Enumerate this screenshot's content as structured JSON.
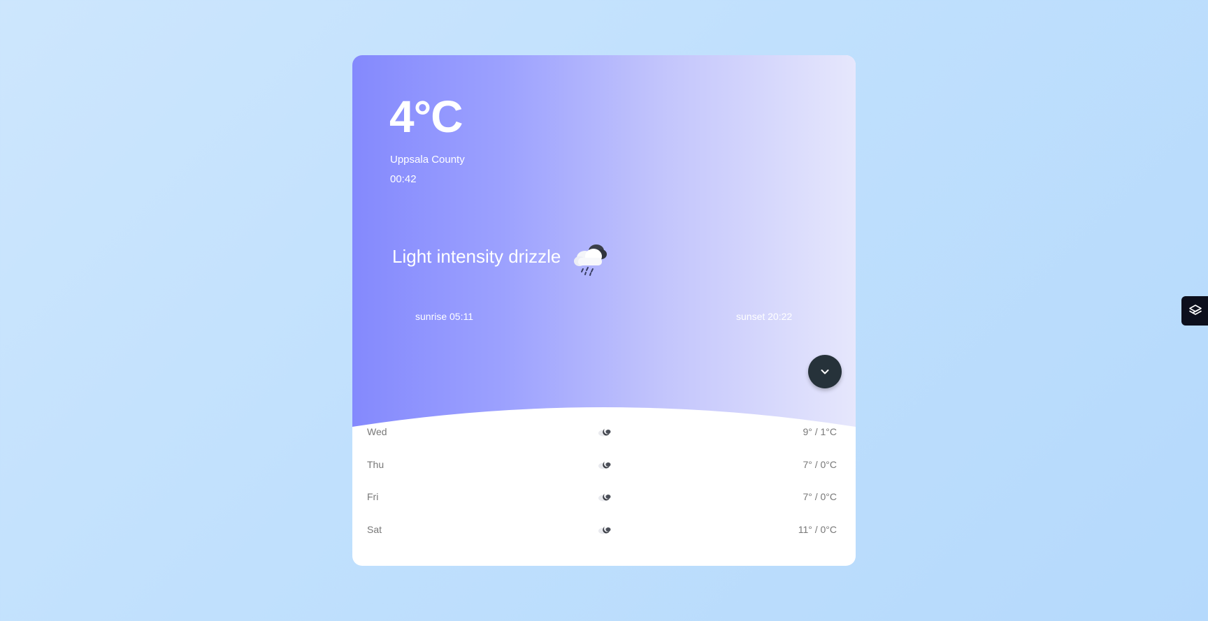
{
  "current": {
    "temperature": "4°C",
    "location": "Uppsala County",
    "time": "00:42",
    "condition": "Light intensity drizzle",
    "condition_icon": "drizzle-cloud-icon",
    "sunrise": "sunrise 05:11",
    "sunset": "sunset 20:22"
  },
  "forecast": [
    {
      "day": "Wed",
      "icon": "partly-cloudy-night-icon",
      "range": "9° / 1°C"
    },
    {
      "day": "Thu",
      "icon": "partly-cloudy-night-icon",
      "range": "7° / 0°C"
    },
    {
      "day": "Fri",
      "icon": "partly-cloudy-night-icon",
      "range": "7° / 0°C"
    },
    {
      "day": "Sat",
      "icon": "partly-cloudy-night-icon",
      "range": "11° / 0°C"
    }
  ],
  "controls": {
    "expand_icon": "chevron-down-icon",
    "side_tab_icon": "layers-icon"
  },
  "colors": {
    "background": "#c0e0fd",
    "hero_start": "#8489fd",
    "hero_end": "#e6e7fc",
    "button": "#26323a",
    "side_tab": "#0c0f1c"
  }
}
